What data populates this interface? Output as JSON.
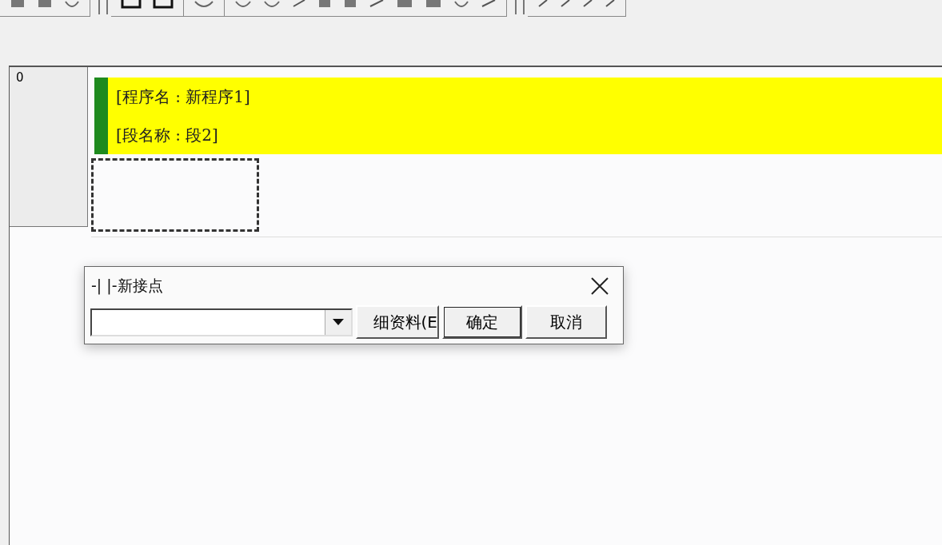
{
  "gutter": {
    "row_number": "0"
  },
  "block": {
    "lines": [
      "[程序名 : 新程序1]",
      "[段名称 : 段2]"
    ]
  },
  "dialog": {
    "title": "-| |-新接点",
    "buttons": [
      {
        "label": "细资料(E",
        "kind": "clipped"
      },
      {
        "label": "确定",
        "kind": "default"
      },
      {
        "label": "取消",
        "kind": "normal"
      }
    ]
  }
}
